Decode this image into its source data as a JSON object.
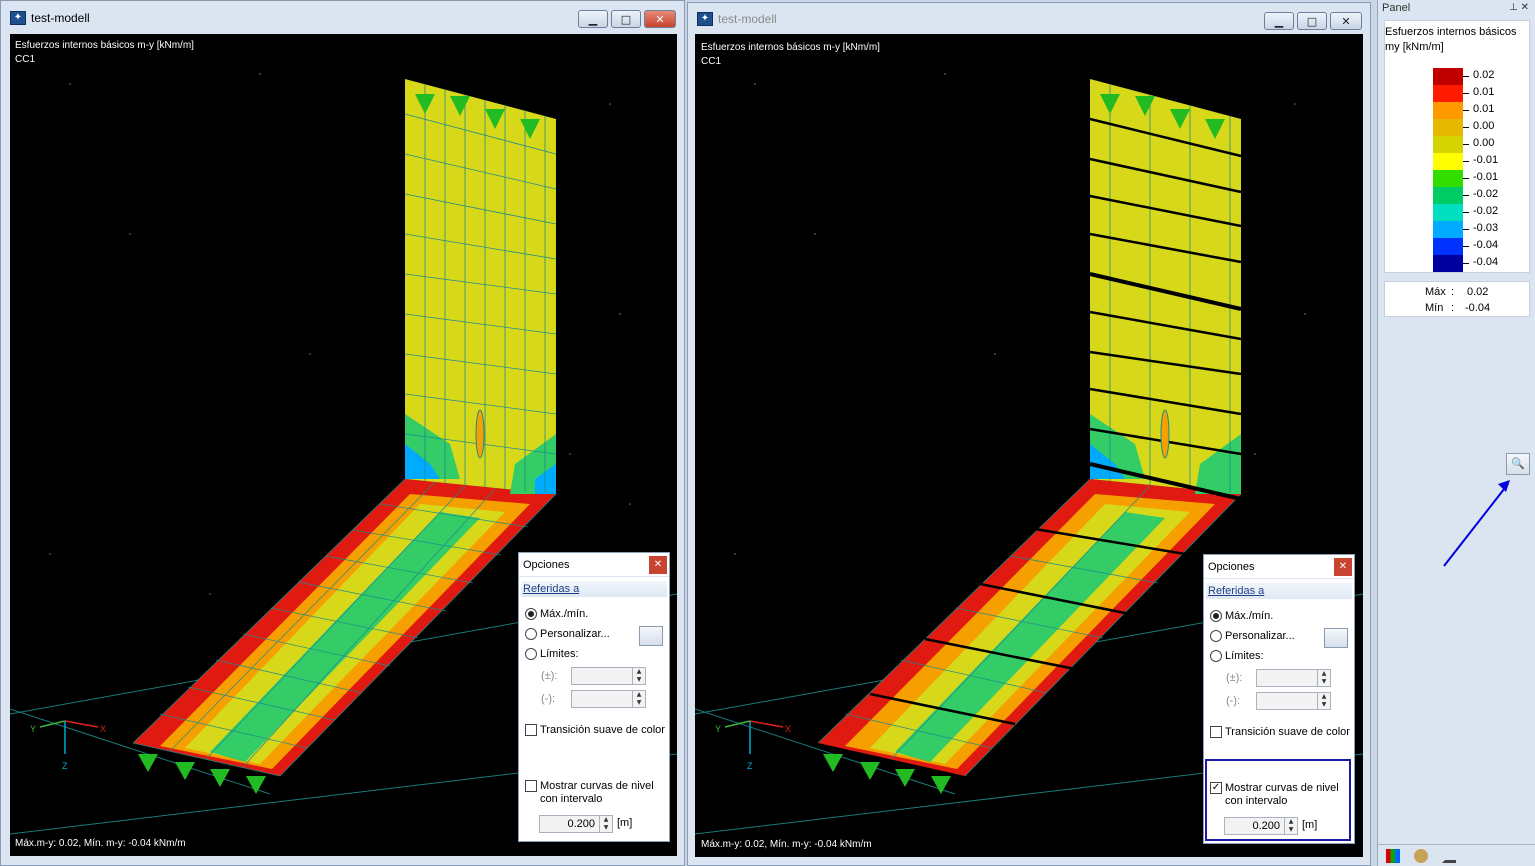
{
  "windows": [
    {
      "title": "test-modell",
      "active": true,
      "viewport": {
        "heading": "Esfuerzos internos básicos m-y [kNm/m]",
        "load_case": "CC1",
        "footer": "Máx.m-y: 0.02, Mín. m-y: -0.04 kNm/m",
        "axes": [
          "X",
          "Y",
          "Z"
        ]
      },
      "options": {
        "title": "Opciones",
        "section": "Referidas a",
        "radio_maxmin": "Máx./mín.",
        "radio_custom": "Personalizar...",
        "radio_limits": "Límites:",
        "plusminus": "(±):",
        "minus": "(-):",
        "smooth": "Transición suave de color",
        "contour_line1": "Mostrar curvas de nivel",
        "contour_line2": "con intervalo",
        "contour_checked": false,
        "interval_value": "0.200",
        "interval_unit": "[m]"
      }
    },
    {
      "title": "test-modell",
      "active": false,
      "viewport": {
        "heading": "Esfuerzos internos básicos m-y [kNm/m]",
        "load_case": "CC1",
        "footer": "Máx.m-y: 0.02, Mín. m-y: -0.04 kNm/m",
        "axes": [
          "X",
          "Y",
          "Z"
        ]
      },
      "options": {
        "title": "Opciones",
        "section": "Referidas a",
        "radio_maxmin": "Máx./mín.",
        "radio_custom": "Personalizar...",
        "radio_limits": "Límites:",
        "plusminus": "(±):",
        "minus": "(-):",
        "smooth": "Transición suave de color",
        "contour_line1": "Mostrar curvas de nivel",
        "contour_line2": "con intervalo",
        "contour_checked": true,
        "interval_value": "0.200",
        "interval_unit": "[m]"
      }
    }
  ],
  "panel": {
    "title": "Panel",
    "legend_title": "Esfuerzos internos básicos",
    "legend_sub": "my [kNm/m]",
    "legend": [
      {
        "value": "0.02",
        "color": "#c00000"
      },
      {
        "value": "0.01",
        "color": "#ff1a00"
      },
      {
        "value": "0.01",
        "color": "#ff9900"
      },
      {
        "value": "0.00",
        "color": "#e6b800"
      },
      {
        "value": "0.00",
        "color": "#d4d400"
      },
      {
        "value": "-0.01",
        "color": "#ffff00"
      },
      {
        "value": "-0.01",
        "color": "#33dd00"
      },
      {
        "value": "-0.02",
        "color": "#00cc66"
      },
      {
        "value": "-0.02",
        "color": "#00e0c0"
      },
      {
        "value": "-0.03",
        "color": "#00aaff"
      },
      {
        "value": "-0.04",
        "color": "#0033ff"
      },
      {
        "value": "-0.04",
        "color": "#0000a0"
      }
    ],
    "max_label": "Máx",
    "max_value": "0.02",
    "min_label": "Mín",
    "min_value": "-0.04"
  },
  "colors": {
    "mesh": "#1c8c8c",
    "red": "#e01a10",
    "orange": "#f5a000",
    "yellow": "#d8d81a",
    "arrow": "#0000dd",
    "support": "#22bb22"
  }
}
